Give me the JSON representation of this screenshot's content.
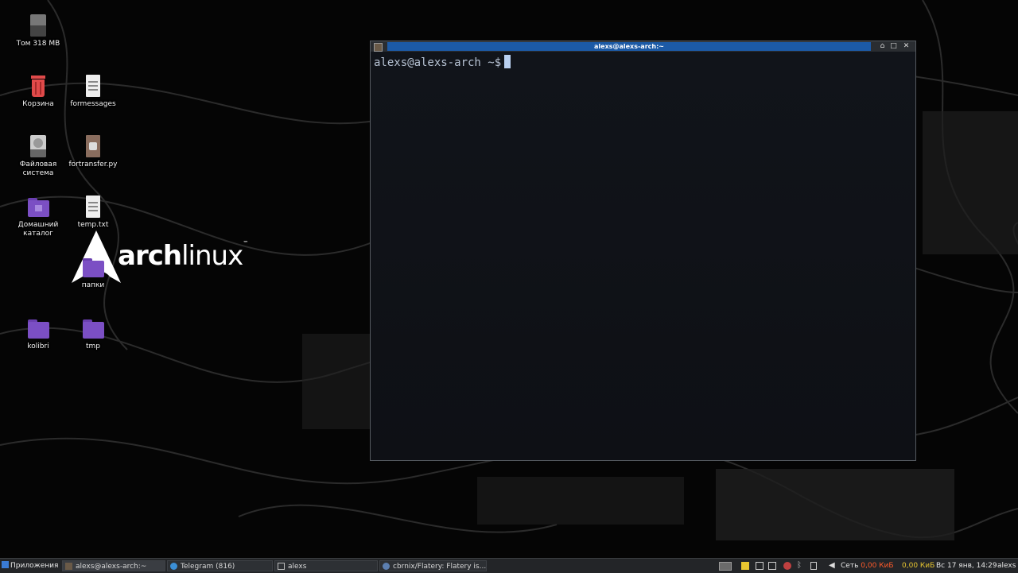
{
  "desktop": {
    "icons": [
      {
        "id": "volume",
        "label": "Том 318 МВ"
      },
      {
        "id": "trash",
        "label": "Корзина"
      },
      {
        "id": "formessages",
        "label": "formessages"
      },
      {
        "id": "filesystem",
        "label": "Файловая система"
      },
      {
        "id": "fortransfer",
        "label": "fortransfer.py"
      },
      {
        "id": "home",
        "label": "Домашний каталог"
      },
      {
        "id": "temp",
        "label": "temp.txt"
      },
      {
        "id": "papki",
        "label": "папки"
      },
      {
        "id": "kolibri",
        "label": "kolibri"
      },
      {
        "id": "tmp",
        "label": "tmp"
      }
    ],
    "logo": {
      "text_bold": "arch",
      "text_light": "linux",
      "mark": "™"
    }
  },
  "terminal": {
    "title": "alexs@alexs-arch:~",
    "prompt": "alexs@alexs-arch ~$"
  },
  "taskbar": {
    "apps_menu": "Приложения",
    "tasks": [
      {
        "label": "alexs@alexs-arch:~"
      },
      {
        "label": "Telegram (816)"
      },
      {
        "label": "alexs"
      },
      {
        "label": "cbrnix/Flatery: Flatery is..."
      }
    ],
    "net_label": "Сеть",
    "net_down": "0,00 КиБ",
    "net_up": "0,00 КиБ",
    "datetime": "Вс 17 янв, 14:29",
    "user": "alexs"
  },
  "colors": {
    "title_active": "#1c5aa6",
    "folder": "#7b4fc4",
    "trash": "#e04a4a",
    "net_red": "#ff5a2a",
    "net_yellow": "#e8c630"
  }
}
